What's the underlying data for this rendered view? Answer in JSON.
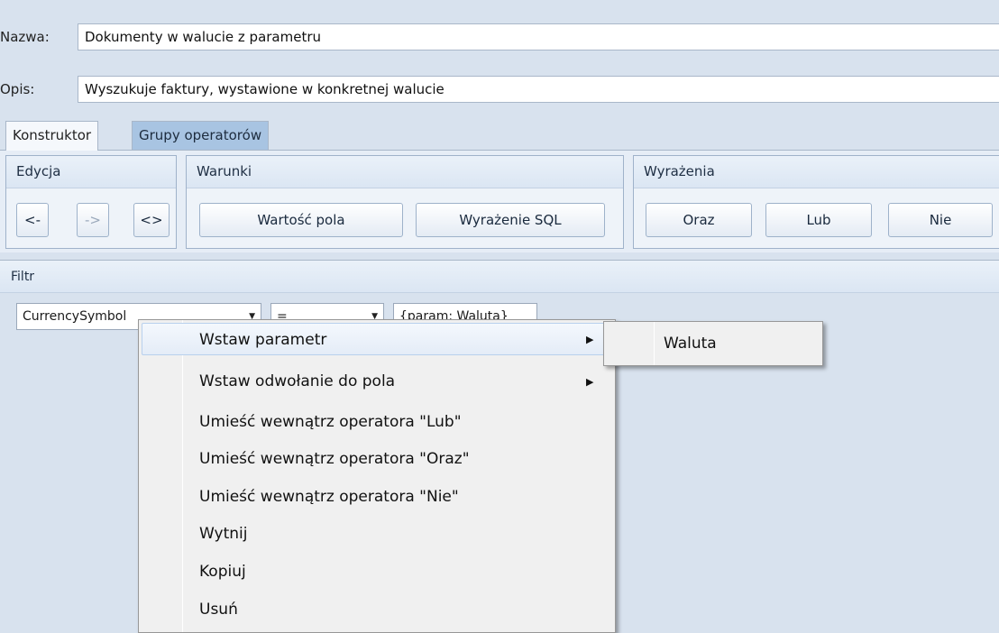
{
  "form": {
    "name_label": "Nazwa:",
    "name_value": "Dokumenty w walucie z parametru",
    "desc_label": "Opis:",
    "desc_value": "Wyszukuje faktury, wystawione w konkretnej walucie"
  },
  "tabs": [
    {
      "label": "Konstruktor",
      "active": true
    },
    {
      "label": "Grupy operatorów",
      "active": false
    }
  ],
  "ribbon": {
    "edit": {
      "title": "Edycja",
      "buttons": [
        "<-",
        "->",
        "<>"
      ]
    },
    "conditions": {
      "title": "Warunki",
      "buttons": [
        "Wartość pola",
        "Wyrażenie SQL"
      ]
    },
    "expressions": {
      "title": "Wyrażenia",
      "buttons": [
        "Oraz",
        "Lub",
        "Nie"
      ]
    }
  },
  "filter": {
    "title": "Filtr",
    "field_combo": "CurrencySymbol",
    "operator_combo": "=",
    "value": "{param: Waluta}"
  },
  "context_menu": {
    "items": [
      {
        "label": "Wstaw parametr",
        "submenu": true
      },
      {
        "label": "Wstaw odwołanie do pola",
        "submenu": true
      },
      {
        "label": "Umieść wewnątrz operatora \"Lub\""
      },
      {
        "label": "Umieść wewnątrz operatora \"Oraz\""
      },
      {
        "label": "Umieść wewnątrz operatora \"Nie\""
      },
      {
        "label": "Wytnij"
      },
      {
        "label": "Kopiuj"
      },
      {
        "label": "Usuń"
      }
    ],
    "submenu_items": [
      "Waluta"
    ]
  },
  "colors": {
    "background": "#d8e2ee",
    "active_tab": "#f5f8fc",
    "inactive_tab": "#a8c4e2",
    "menu_bg": "#f0f0f0"
  }
}
